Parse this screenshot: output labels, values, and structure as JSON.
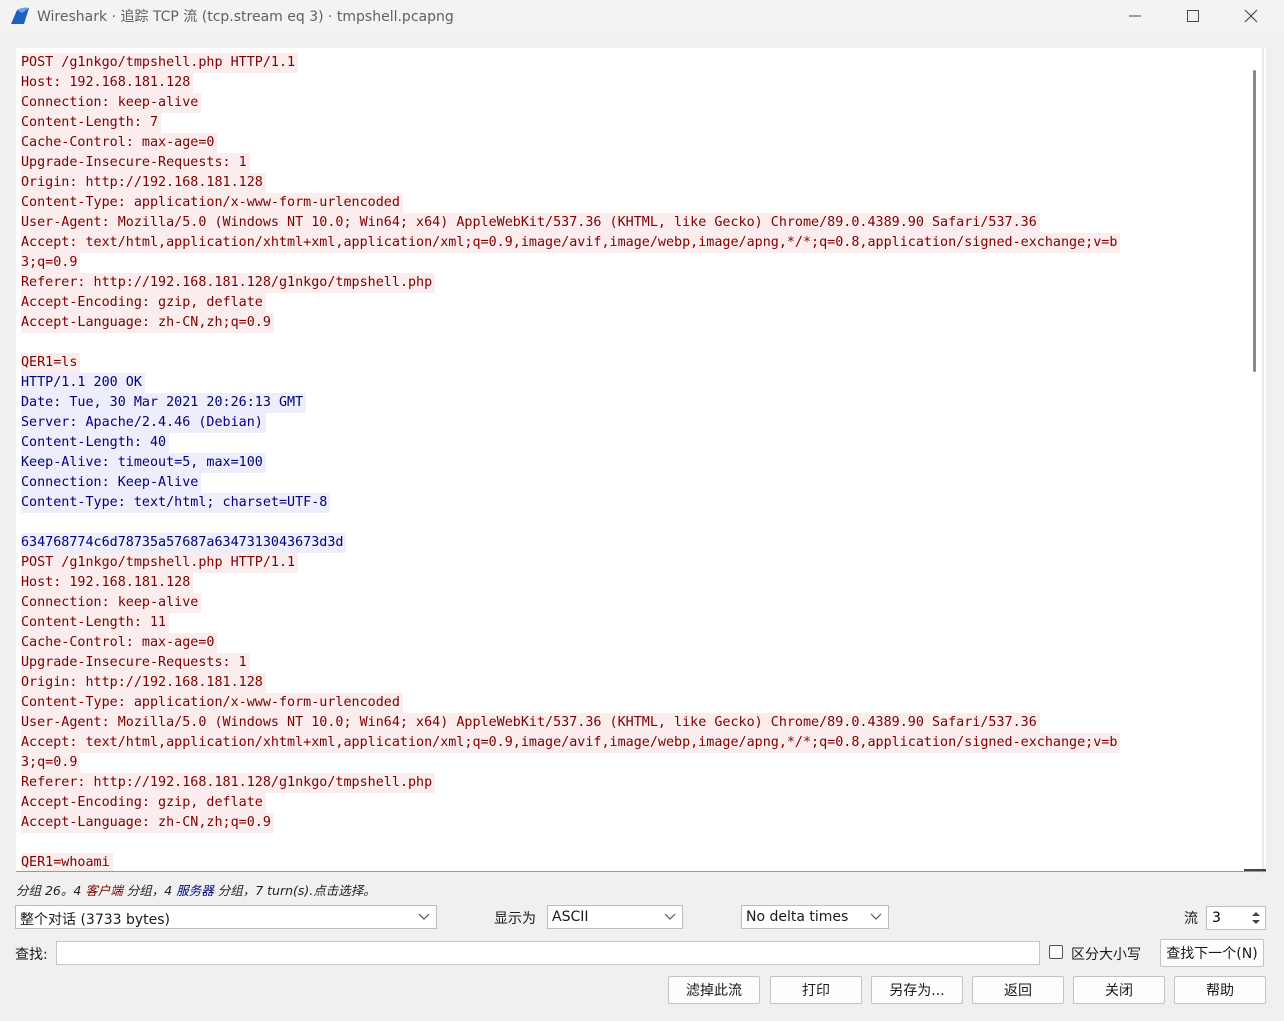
{
  "window": {
    "title": "Wireshark · 追踪 TCP 流 (tcp.stream eq 3) · tmpshell.pcapng",
    "app_icon": "wireshark-fin-icon",
    "controls": [
      "minimize-icon",
      "maximize-icon",
      "close-icon"
    ]
  },
  "colors": {
    "client_text": "#7f0000",
    "client_bg": "#fbeded",
    "server_text": "#00007f",
    "server_bg": "#ededfb",
    "app_icon": "#1f5fbf"
  },
  "stream": {
    "lines": [
      {
        "dir": "client",
        "text": "POST /g1nkgo/tmpshell.php HTTP/1.1"
      },
      {
        "dir": "client",
        "text": "Host: 192.168.181.128"
      },
      {
        "dir": "client",
        "text": "Connection: keep-alive"
      },
      {
        "dir": "client",
        "text": "Content-Length: 7"
      },
      {
        "dir": "client",
        "text": "Cache-Control: max-age=0"
      },
      {
        "dir": "client",
        "text": "Upgrade-Insecure-Requests: 1"
      },
      {
        "dir": "client",
        "text": "Origin: http://192.168.181.128"
      },
      {
        "dir": "client",
        "text": "Content-Type: application/x-www-form-urlencoded"
      },
      {
        "dir": "client",
        "text": "User-Agent: Mozilla/5.0 (Windows NT 10.0; Win64; x64) AppleWebKit/537.36 (KHTML, like Gecko) Chrome/89.0.4389.90 Safari/537.36"
      },
      {
        "dir": "client",
        "text": "Accept: text/html,application/xhtml+xml,application/xml;q=0.9,image/avif,image/webp,image/apng,*/*;q=0.8,application/signed-exchange;v=b"
      },
      {
        "dir": "client",
        "text": "3;q=0.9"
      },
      {
        "dir": "client",
        "text": "Referer: http://192.168.181.128/g1nkgo/tmpshell.php"
      },
      {
        "dir": "client",
        "text": "Accept-Encoding: gzip, deflate"
      },
      {
        "dir": "client",
        "text": "Accept-Language: zh-CN,zh;q=0.9"
      },
      {
        "dir": "blank",
        "text": ""
      },
      {
        "dir": "client",
        "text": "QER1=ls"
      },
      {
        "dir": "server",
        "text": "HTTP/1.1 200 OK"
      },
      {
        "dir": "server",
        "text": "Date: Tue, 30 Mar 2021 20:26:13 GMT"
      },
      {
        "dir": "server",
        "text": "Server: Apache/2.4.46 (Debian)"
      },
      {
        "dir": "server",
        "text": "Content-Length: 40"
      },
      {
        "dir": "server",
        "text": "Keep-Alive: timeout=5, max=100"
      },
      {
        "dir": "server",
        "text": "Connection: Keep-Alive"
      },
      {
        "dir": "server",
        "text": "Content-Type: text/html; charset=UTF-8"
      },
      {
        "dir": "blank",
        "text": ""
      },
      {
        "dir": "server",
        "text": "634768774c6d78735a57687a6347313043673d3d"
      },
      {
        "dir": "client",
        "text": "POST /g1nkgo/tmpshell.php HTTP/1.1"
      },
      {
        "dir": "client",
        "text": "Host: 192.168.181.128"
      },
      {
        "dir": "client",
        "text": "Connection: keep-alive"
      },
      {
        "dir": "client",
        "text": "Content-Length: 11"
      },
      {
        "dir": "client",
        "text": "Cache-Control: max-age=0"
      },
      {
        "dir": "client",
        "text": "Upgrade-Insecure-Requests: 1"
      },
      {
        "dir": "client",
        "text": "Origin: http://192.168.181.128"
      },
      {
        "dir": "client",
        "text": "Content-Type: application/x-www-form-urlencoded"
      },
      {
        "dir": "client",
        "text": "User-Agent: Mozilla/5.0 (Windows NT 10.0; Win64; x64) AppleWebKit/537.36 (KHTML, like Gecko) Chrome/89.0.4389.90 Safari/537.36"
      },
      {
        "dir": "client",
        "text": "Accept: text/html,application/xhtml+xml,application/xml;q=0.9,image/avif,image/webp,image/apng,*/*;q=0.8,application/signed-exchange;v=b"
      },
      {
        "dir": "client",
        "text": "3;q=0.9"
      },
      {
        "dir": "client",
        "text": "Referer: http://192.168.181.128/g1nkgo/tmpshell.php"
      },
      {
        "dir": "client",
        "text": "Accept-Encoding: gzip, deflate"
      },
      {
        "dir": "client",
        "text": "Accept-Language: zh-CN,zh;q=0.9"
      },
      {
        "dir": "blank",
        "text": ""
      },
      {
        "dir": "client",
        "text": "QER1=whoami"
      }
    ]
  },
  "status": {
    "part1": "分组 26。4 ",
    "client": "客户端",
    "part2": " 分组，4 ",
    "server": "服务器",
    "part3": " 分组，7 turn(s).点击选择。"
  },
  "controls": {
    "conversation_value": "整个对话 (3733 bytes)",
    "display_as_label": "显示为",
    "display_as_value": "ASCII",
    "delta_value": "No delta times",
    "stream_label": "流",
    "stream_value": "3",
    "find_label": "查找:",
    "find_value": "",
    "case_label": "区分大小写",
    "find_next": "查找下一个(N)"
  },
  "buttons": {
    "filter_out": "滤掉此流",
    "print": "打印",
    "save_as": "另存为...",
    "back": "返回",
    "close": "关闭",
    "help": "帮助"
  }
}
